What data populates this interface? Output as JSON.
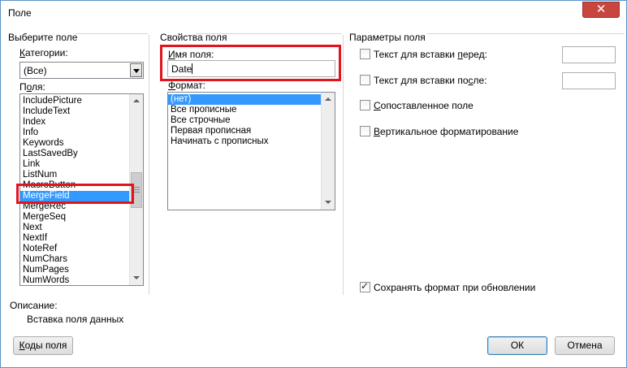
{
  "window": {
    "title": "Поле",
    "close_label": "✕"
  },
  "left_group": {
    "title": "Выберите поле",
    "categories_label_pre": "",
    "categories_label_u": "К",
    "categories_label_post": "атегории:",
    "categories_value": "(Все)",
    "fields_label_pre": "П",
    "fields_label_u": "о",
    "fields_label_post": "ля:",
    "fields": [
      "IncludePicture",
      "IncludeText",
      "Index",
      "Info",
      "Keywords",
      "LastSavedBy",
      "Link",
      "ListNum",
      "MacroButton",
      "MergeField",
      "MergeRec",
      "MergeSeq",
      "Next",
      "NextIf",
      "NoteRef",
      "NumChars",
      "NumPages",
      "NumWords"
    ],
    "selected_field": "MergeField"
  },
  "middle_group": {
    "title": "Свойства поля",
    "field_name_label_pre": "",
    "field_name_label_u": "И",
    "field_name_label_post": "мя поля:",
    "field_name_value": "Date",
    "format_label_pre": "",
    "format_label_u": "Ф",
    "format_label_post": "ормат:",
    "formats": [
      "(нет)",
      "Все прописные",
      "Все строчные",
      "Первая прописная",
      "Начинать с прописных"
    ],
    "selected_format": "(нет)"
  },
  "right_group": {
    "title": "Параметры поля",
    "text_before": {
      "pre": "Текст для вставки ",
      "u": "п",
      "post": "еред:",
      "checked": false,
      "value": ""
    },
    "text_after": {
      "pre": "Текст для вставки по",
      "u": "с",
      "post": "ле:",
      "checked": false,
      "value": ""
    },
    "mapped_field": {
      "pre": "",
      "u": "С",
      "post": "опоставленное поле",
      "checked": false
    },
    "vertical_format": {
      "pre": "",
      "u": "В",
      "post": "ертикальное форматирование",
      "checked": false
    },
    "preserve_format": {
      "label": "Сохранять формат при обновлении",
      "checked": true
    }
  },
  "description": {
    "label": "Описание:",
    "text": "Вставка поля данных"
  },
  "buttons": {
    "field_codes_u": "К",
    "field_codes_post": "оды поля",
    "ok": "ОК",
    "cancel": "Отмена"
  },
  "colors": {
    "selection": "#3399ff",
    "highlight": "#e0151d",
    "close_button": "#c7463d"
  }
}
